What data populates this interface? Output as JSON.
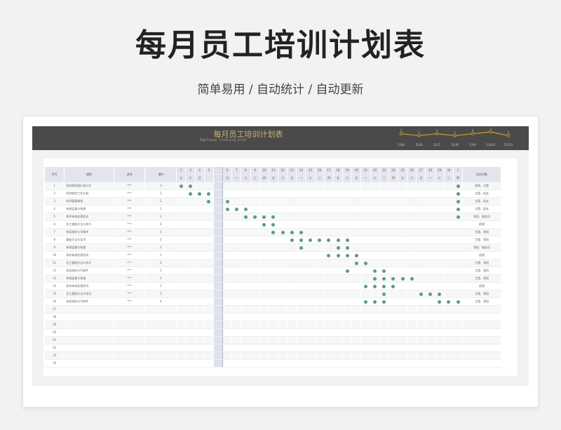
{
  "page": {
    "title": "每月员工培训计划表",
    "subtitle": "简单易用 / 自动统计 / 自动更新"
  },
  "banner": {
    "title": "每月员工培训计划表",
    "subtitle": "Employee training plan"
  },
  "trend": {
    "dates": [
      "11/6",
      "11/6",
      "11/7",
      "11/8",
      "11/9",
      "11/10",
      "11/11"
    ],
    "values": [
      2,
      1,
      2,
      1,
      2,
      3,
      1
    ],
    "color": "#c9a227"
  },
  "table": {
    "headers": {
      "no": "序号",
      "course": "课程",
      "lecturer": "讲师",
      "hours": "课时",
      "target": "培训对象"
    },
    "days": [
      "2",
      "3",
      "4",
      "5",
      "",
      "6",
      "7",
      "8",
      "9",
      "10",
      "11",
      "12",
      "13",
      "14",
      "15",
      "16",
      "17",
      "18",
      "19",
      "20",
      "21",
      "22",
      "23",
      "24",
      "25",
      "26",
      "27",
      "28",
      "29",
      "30",
      "1"
    ],
    "weekdays": [
      "五",
      "六",
      "日",
      "",
      "",
      "日",
      "一",
      "二",
      "三",
      "四",
      "五",
      "六",
      "日",
      "一",
      "二",
      "三",
      "四",
      "五",
      "六",
      "日",
      "一",
      "二",
      "三",
      "四",
      "五",
      "六",
      "日",
      "一",
      "二",
      "三",
      "四"
    ],
    "sep_index": 4,
    "rows": [
      {
        "no": "1",
        "course": "如何提高团队执行力",
        "lecturer": "***",
        "hours": "3",
        "target": "经理、主管",
        "dots": [
          0,
          1,
          30
        ]
      },
      {
        "no": "2",
        "course": "如何制定工作计划",
        "lecturer": "***",
        "hours": "1",
        "target": "主管、组长",
        "dots": [
          1,
          2,
          3,
          30
        ]
      },
      {
        "no": "3",
        "course": "时间管理课程",
        "lecturer": "***",
        "hours": "2",
        "target": "主管、组长",
        "dots": [
          3,
          5,
          30
        ]
      },
      {
        "no": "4",
        "course": "有效监督与检查",
        "lecturer": "***",
        "hours": "1",
        "target": "主管、组长",
        "dots": [
          5,
          6,
          7,
          30
        ]
      },
      {
        "no": "5",
        "course": "如何有效处理投诉",
        "lecturer": "***",
        "hours": "3",
        "target": "领班、服务员",
        "dots": [
          7,
          8,
          9,
          10,
          30
        ]
      },
      {
        "no": "6",
        "course": "员工激励方法与技巧",
        "lecturer": "***",
        "hours": "2",
        "target": "经理",
        "dots": [
          9,
          10
        ]
      },
      {
        "no": "7",
        "course": "电话接听与写邮件",
        "lecturer": "***",
        "hours": "1",
        "target": "主管、领班",
        "dots": [
          10,
          11,
          12,
          13
        ]
      },
      {
        "no": "8",
        "course": "激励方法与话术",
        "lecturer": "***",
        "hours": "1",
        "target": "主管、领班",
        "dots": [
          12,
          13,
          14,
          15,
          16,
          17,
          18
        ]
      },
      {
        "no": "9",
        "course": "有效监督与检查",
        "lecturer": "***",
        "hours": "2",
        "target": "领班、服务员",
        "dots": [
          13,
          17,
          18
        ]
      },
      {
        "no": "10",
        "course": "如何有效处理投诉",
        "lecturer": "***",
        "hours": "1",
        "target": "经理",
        "dots": [
          16,
          17,
          18,
          19
        ]
      },
      {
        "no": "11",
        "course": "员工激励方法与技巧",
        "lecturer": "***",
        "hours": "2",
        "target": "主管、领班",
        "dots": [
          19,
          20
        ]
      },
      {
        "no": "12",
        "course": "电话接听与写邮件",
        "lecturer": "***",
        "hours": "1",
        "target": "主管、领班",
        "dots": [
          18,
          21,
          22
        ]
      },
      {
        "no": "13",
        "course": "有效监督与检查",
        "lecturer": "***",
        "hours": "1",
        "target": "主管、领班",
        "dots": [
          21,
          22,
          23,
          24,
          25
        ]
      },
      {
        "no": "14",
        "course": "如何有效处理投诉",
        "lecturer": "***",
        "hours": "1",
        "target": "经理",
        "dots": [
          20,
          21,
          22,
          23
        ]
      },
      {
        "no": "15",
        "course": "员工激励方法与技巧",
        "lecturer": "***",
        "hours": "3",
        "target": "主管、领班",
        "dots": [
          22,
          26,
          27,
          28
        ]
      },
      {
        "no": "16",
        "course": "电话接听与写邮件",
        "lecturer": "***",
        "hours": "4",
        "target": "主管、领班",
        "dots": [
          20,
          21,
          22,
          28,
          29,
          30
        ]
      },
      {
        "no": "17"
      },
      {
        "no": "18"
      },
      {
        "no": "19"
      },
      {
        "no": "20"
      },
      {
        "no": "21"
      },
      {
        "no": "22"
      },
      {
        "no": "23"
      },
      {
        "no": "24"
      }
    ]
  }
}
